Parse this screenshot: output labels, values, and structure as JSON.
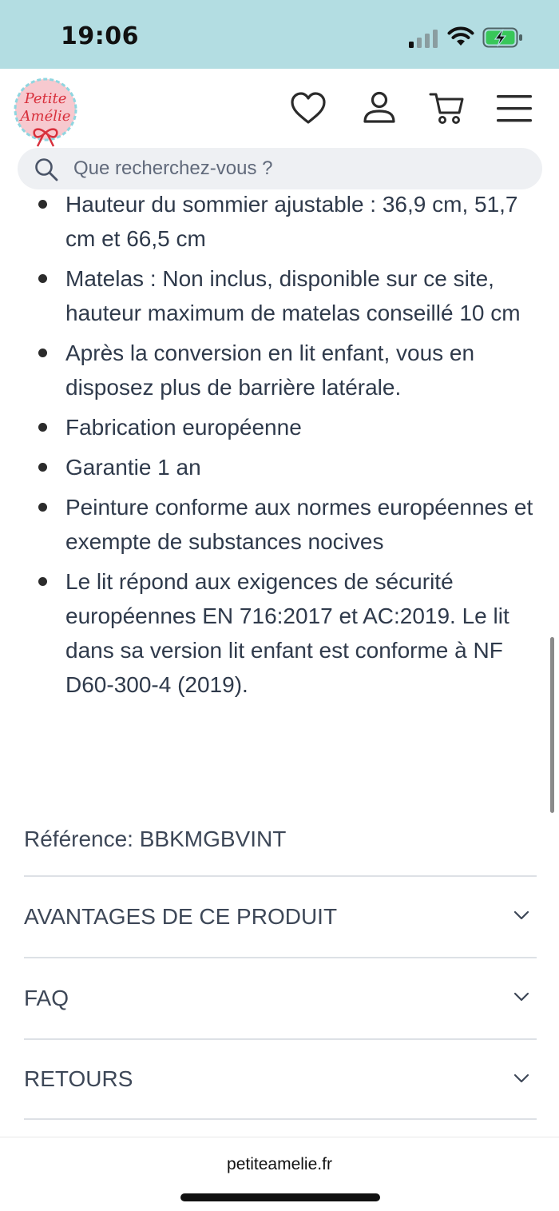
{
  "status_bar": {
    "time": "19:06",
    "icons": [
      "cellular-signal-icon",
      "wifi-icon",
      "battery-charging-icon"
    ]
  },
  "header": {
    "logo_text_line1": "Petite",
    "logo_text_line2": "Amélie",
    "icons": [
      "heart-icon",
      "user-icon",
      "cart-icon",
      "menu-icon"
    ]
  },
  "search": {
    "placeholder": "Que recherchez-vous ?"
  },
  "features": [
    "Hauteur du sommier ajustable : 36,9 cm, 51,7 cm et 66,5 cm",
    "Matelas : Non inclus, disponible sur ce site, hauteur maximum de matelas conseillé 10 cm",
    "Après la conversion en lit enfant, vous en disposez plus de barrière latérale.",
    "Fabrication européenne",
    "Garantie 1 an",
    "Peinture conforme aux normes européennes et exempte de substances nocives",
    "Le lit répond aux exigences de sécurité européennes EN 716:2017 et AC:2019. Le lit dans sa version lit enfant est conforme à NF D60-300-4 (2019)."
  ],
  "reference": "Référence: BBKMGBVINT",
  "accordion": [
    {
      "label": "AVANTAGES DE CE PRODUIT"
    },
    {
      "label": "FAQ"
    },
    {
      "label": "RETOURS"
    }
  ],
  "browser": {
    "url": "petiteamelie.fr"
  },
  "colors": {
    "status_bar_bg": "#b3dde2",
    "logo_pink": "#f7c9cf",
    "logo_red": "#d8303c",
    "text": "#2f3a4b"
  }
}
